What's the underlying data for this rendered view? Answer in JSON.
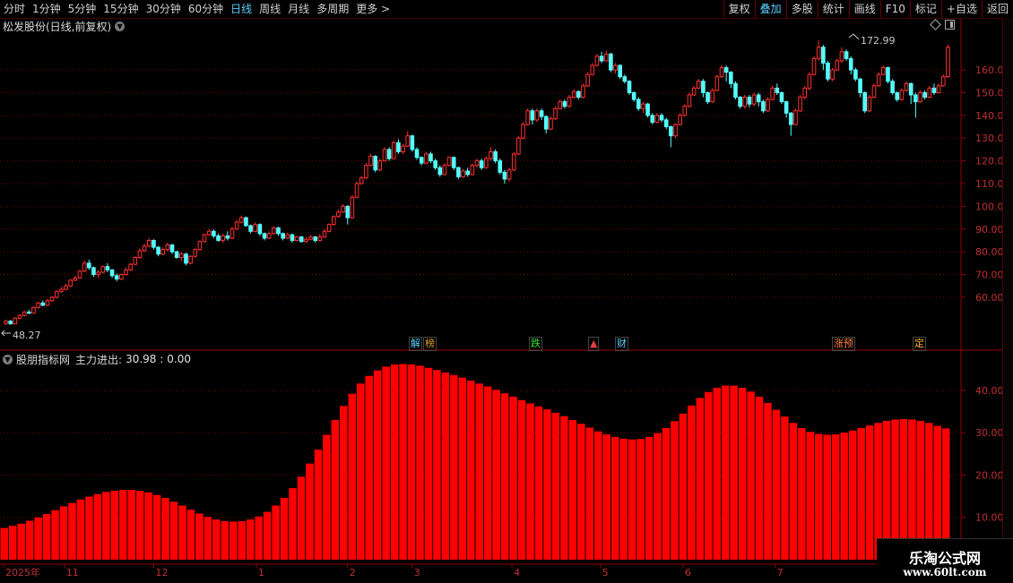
{
  "toolbar": {
    "periods": [
      "分时",
      "1分钟",
      "5分钟",
      "15分钟",
      "30分钟",
      "60分钟",
      "日线",
      "周线",
      "月线",
      "多周期",
      "更多 >"
    ],
    "active_period": "日线",
    "right_buttons": [
      "复权",
      "叠加",
      "多股",
      "统计",
      "画线",
      "F10",
      "标记",
      "+自选",
      "返回"
    ],
    "active_right": "叠加"
  },
  "main": {
    "title": "松发股份(日线,前复权)",
    "high_label": "172.99",
    "low_label": "48.27",
    "price_ticks": [
      "160.0",
      "150.0",
      "140.0",
      "130.0",
      "120.0",
      "110.0",
      "100.0",
      "90.00",
      "80.00",
      "70.00",
      "60.00"
    ]
  },
  "events": [
    {
      "label": "解",
      "color": "#5ad0ff"
    },
    {
      "label": "榜",
      "color": "#e0a020"
    },
    {
      "label": "跌",
      "color": "#30e030"
    },
    {
      "label": "▲",
      "color": "#e04040"
    },
    {
      "label": "财",
      "color": "#5ad0ff"
    },
    {
      "label": "涨预",
      "color": "#ff8040"
    },
    {
      "label": "定",
      "color": "#ffb040"
    }
  ],
  "indicator": {
    "title": "股朋指标网",
    "name": "主力进出:",
    "value": "30.98",
    "value2": ": 0.00",
    "ticks": [
      "40.00",
      "30.00",
      "20.00",
      "10.00"
    ]
  },
  "date_axis": {
    "labels": [
      "2025年",
      "11",
      "12",
      "1",
      "2",
      "3",
      "4",
      "5",
      "6",
      "7"
    ]
  },
  "watermark": {
    "line1": "乐淘公式网",
    "line2": "www.60lt.com"
  },
  "colors": {
    "up": "#ff3030",
    "down": "#54ffff",
    "bar": "#ff0000",
    "grid": "#7a0000",
    "axis_text": "#c03030"
  },
  "chart_data": {
    "type": "candlestick",
    "price_range": [
      45,
      175
    ],
    "indicator_type": "bar",
    "indicator_range": [
      0,
      48
    ],
    "indicator_values": [
      7.5,
      8,
      8.5,
      9.2,
      10,
      10.8,
      11.7,
      12.6,
      13.4,
      14.2,
      14.9,
      15.5,
      16,
      16.3,
      16.5,
      16.5,
      16.3,
      15.9,
      15.3,
      14.6,
      13.7,
      12.8,
      11.8,
      10.9,
      10.1,
      9.5,
      9.1,
      9.0,
      9.1,
      9.5,
      10.2,
      11.3,
      12.8,
      14.6,
      16.9,
      19.6,
      22.7,
      26,
      29.5,
      33,
      36.3,
      39.2,
      41.6,
      43.4,
      44.7,
      45.6,
      46.1,
      46.2,
      46.1,
      45.8,
      45.3,
      44.8,
      44.2,
      43.6,
      43,
      42.3,
      41.6,
      40.9,
      40.1,
      39.3,
      38.5,
      37.7,
      36.9,
      36.2,
      35.5,
      34.7,
      33.9,
      33,
      32.1,
      31.2,
      30.3,
      29.6,
      29,
      28.6,
      28.4,
      28.5,
      29,
      29.9,
      31.1,
      32.7,
      34.5,
      36.4,
      38.2,
      39.6,
      40.6,
      41.1,
      41.1,
      40.6,
      39.7,
      38.5,
      37,
      35.4,
      33.8,
      32.3,
      31.1,
      30.2,
      29.7,
      29.5,
      29.6,
      30,
      30.5,
      31.1,
      31.7,
      32.3,
      32.8,
      33.1,
      33.2,
      33.1,
      32.8,
      32.3,
      31.6,
      31.0
    ],
    "candles": [
      [
        48.5,
        49.5,
        50.2,
        47.8
      ],
      [
        49.5,
        48.3,
        50,
        48
      ],
      [
        48.3,
        50.8,
        51.2,
        48.1
      ],
      [
        50.8,
        52,
        52.5,
        50.2
      ],
      [
        52,
        53.5,
        54,
        51.5
      ],
      [
        53.5,
        53,
        54.5,
        52.5
      ],
      [
        53,
        55.5,
        56,
        52.8
      ],
      [
        55.5,
        57.5,
        58,
        55
      ],
      [
        57.5,
        56.5,
        58.5,
        56
      ],
      [
        56.5,
        58.5,
        59.2,
        56
      ],
      [
        58.5,
        60,
        60.5,
        58
      ],
      [
        60,
        62.5,
        63,
        59.5
      ],
      [
        62.5,
        63.5,
        64.5,
        62
      ],
      [
        63.5,
        65,
        66,
        63
      ],
      [
        65,
        67.5,
        68,
        64.5
      ],
      [
        67.5,
        68.5,
        69.5,
        67
      ],
      [
        68.5,
        71.5,
        72,
        68
      ],
      [
        71.5,
        75,
        76,
        71
      ],
      [
        75,
        73,
        76.5,
        72
      ],
      [
        73,
        70,
        73.5,
        69
      ],
      [
        70,
        71,
        72,
        68.5
      ],
      [
        71,
        73.5,
        74,
        70.5
      ],
      [
        73.5,
        72,
        75,
        71
      ],
      [
        72,
        69.5,
        72.5,
        68.5
      ],
      [
        69.5,
        68,
        70.5,
        67
      ],
      [
        68,
        70,
        70.5,
        67.5
      ],
      [
        70,
        72,
        73,
        69.5
      ],
      [
        72,
        74.5,
        75,
        71.5
      ],
      [
        74.5,
        77.5,
        78,
        74
      ],
      [
        77.5,
        80.5,
        81.5,
        77
      ],
      [
        80.5,
        82.5,
        83.5,
        80
      ],
      [
        82.5,
        85,
        86,
        82
      ],
      [
        85,
        82,
        85.5,
        81
      ],
      [
        82,
        79,
        82.5,
        78
      ],
      [
        79,
        81,
        82,
        78.5
      ],
      [
        81,
        83,
        84,
        80
      ],
      [
        83,
        80,
        83.5,
        79
      ],
      [
        80,
        77.5,
        80.5,
        77
      ],
      [
        77.5,
        79,
        80,
        76
      ],
      [
        79,
        75,
        79.5,
        74
      ],
      [
        75,
        78,
        78.5,
        74.5
      ],
      [
        78,
        81,
        81.5,
        77.5
      ],
      [
        81,
        84.5,
        85,
        80.5
      ],
      [
        84.5,
        87.5,
        88,
        84
      ],
      [
        87.5,
        89,
        90,
        87
      ],
      [
        89,
        87,
        90,
        86
      ],
      [
        87,
        85,
        88,
        84.5
      ],
      [
        85,
        87,
        88,
        84
      ],
      [
        87,
        86,
        89,
        85
      ],
      [
        86,
        90,
        91,
        85.5
      ],
      [
        90,
        93,
        94,
        89.5
      ],
      [
        93,
        95,
        96,
        92.5
      ],
      [
        95,
        91.5,
        95.5,
        91
      ],
      [
        91.5,
        89,
        92,
        88
      ],
      [
        89,
        92,
        93,
        88.5
      ],
      [
        92,
        88,
        92.5,
        87
      ],
      [
        88,
        86,
        88.5,
        85
      ],
      [
        86,
        88,
        89,
        85.5
      ],
      [
        88,
        90.5,
        91,
        87.5
      ],
      [
        90.5,
        88,
        91,
        87
      ],
      [
        88,
        86,
        88.5,
        85
      ],
      [
        86,
        87.5,
        88.5,
        85.5
      ],
      [
        87.5,
        85,
        88,
        84
      ],
      [
        85,
        86.5,
        87,
        84.5
      ],
      [
        86.5,
        84.5,
        87,
        84
      ],
      [
        84.5,
        85.5,
        86.5,
        84
      ],
      [
        85.5,
        86.5,
        87.5,
        85
      ],
      [
        86.5,
        85,
        87,
        84
      ],
      [
        85,
        86.5,
        88,
        84.5
      ],
      [
        86.5,
        89,
        90,
        86
      ],
      [
        89,
        92,
        92.5,
        88.5
      ],
      [
        92,
        95.5,
        96,
        91.5
      ],
      [
        95.5,
        97.5,
        98.5,
        95
      ],
      [
        97.5,
        100,
        101,
        97
      ],
      [
        100,
        95,
        100.5,
        92
      ],
      [
        95,
        104,
        105,
        94.5
      ],
      [
        104,
        110,
        111,
        103.5
      ],
      [
        110,
        112.5,
        113.5,
        109.5
      ],
      [
        112.5,
        118,
        119,
        112
      ],
      [
        118,
        122,
        123,
        117.5
      ],
      [
        122,
        116,
        122.5,
        115
      ],
      [
        116,
        120,
        121,
        115.5
      ],
      [
        120,
        125,
        126,
        119.5
      ],
      [
        125,
        121,
        126,
        120
      ],
      [
        121,
        128,
        129,
        120.5
      ],
      [
        128,
        124,
        129.5,
        123
      ],
      [
        124,
        126.5,
        127.5,
        123
      ],
      [
        126.5,
        131,
        133,
        126
      ],
      [
        131,
        125,
        131.5,
        124
      ],
      [
        125,
        121.5,
        126,
        120.5
      ],
      [
        121.5,
        119,
        122,
        118
      ],
      [
        119,
        123,
        124,
        118.5
      ],
      [
        123,
        120,
        124,
        119
      ],
      [
        120,
        117,
        121,
        116
      ],
      [
        117,
        114,
        118,
        113
      ],
      [
        114,
        118,
        119,
        113.5
      ],
      [
        118,
        121.5,
        122,
        117.5
      ],
      [
        121.5,
        117,
        122,
        116
      ],
      [
        117,
        113,
        117.5,
        112
      ],
      [
        113,
        115.5,
        116.5,
        112.5
      ],
      [
        115.5,
        114,
        117,
        113
      ],
      [
        114,
        118,
        119,
        113.5
      ],
      [
        118,
        120,
        121,
        117
      ],
      [
        120,
        117,
        121,
        116
      ],
      [
        117,
        121,
        122,
        116.5
      ],
      [
        121,
        124,
        126,
        120
      ],
      [
        124,
        120,
        125,
        119
      ],
      [
        120,
        115,
        121,
        114
      ],
      [
        115,
        112,
        116,
        110
      ],
      [
        112,
        116,
        117,
        111
      ],
      [
        116,
        123,
        124,
        115.5
      ],
      [
        123,
        130,
        131,
        122.5
      ],
      [
        130,
        136,
        137,
        129.5
      ],
      [
        136,
        142,
        143,
        135.5
      ],
      [
        142,
        138,
        143,
        136
      ],
      [
        138,
        142,
        143,
        137
      ],
      [
        142,
        139.5,
        143,
        138
      ],
      [
        139.5,
        134,
        140,
        132
      ],
      [
        134,
        138.5,
        139.5,
        133.5
      ],
      [
        138.5,
        143,
        144,
        138
      ],
      [
        143,
        146,
        147,
        142.5
      ],
      [
        146,
        144,
        147,
        143
      ],
      [
        144,
        148,
        149,
        143.5
      ],
      [
        148,
        150.5,
        151.5,
        147.5
      ],
      [
        150.5,
        148,
        151,
        147
      ],
      [
        148,
        153,
        154,
        147.5
      ],
      [
        153,
        158,
        159,
        152.5
      ],
      [
        158,
        162,
        163,
        157.5
      ],
      [
        162,
        166,
        167,
        161.5
      ],
      [
        166,
        164,
        168,
        163
      ],
      [
        164,
        167,
        168.5,
        163.5
      ],
      [
        167,
        160,
        167.5,
        159
      ],
      [
        160,
        162,
        163,
        158.5
      ],
      [
        162,
        157,
        162.5,
        156
      ],
      [
        157,
        155,
        158,
        154
      ],
      [
        155,
        150,
        155.5,
        149
      ],
      [
        150,
        147,
        150.5,
        146
      ],
      [
        147,
        143,
        148,
        142
      ],
      [
        143,
        145,
        146,
        141
      ],
      [
        145,
        140,
        145.5,
        139
      ],
      [
        140,
        137,
        141,
        136
      ],
      [
        137,
        140,
        141,
        136.5
      ],
      [
        140,
        138,
        141,
        137
      ],
      [
        138,
        135,
        139,
        134
      ],
      [
        135,
        131,
        135.5,
        126
      ],
      [
        131,
        136,
        136.5,
        130
      ],
      [
        136,
        140,
        141,
        135.5
      ],
      [
        140,
        144,
        145,
        139.5
      ],
      [
        144,
        149,
        150,
        143.5
      ],
      [
        149,
        152,
        153,
        148.5
      ],
      [
        152,
        155,
        156,
        151.5
      ],
      [
        155,
        150,
        156,
        148
      ],
      [
        150,
        146,
        150.5,
        145
      ],
      [
        146,
        151,
        152,
        145.5
      ],
      [
        151,
        157,
        158,
        150.5
      ],
      [
        157,
        161,
        162,
        156.5
      ],
      [
        161,
        159,
        162,
        155
      ],
      [
        159,
        154,
        159.5,
        152
      ],
      [
        154,
        148,
        155,
        147
      ],
      [
        148,
        144,
        148.5,
        143
      ],
      [
        144,
        148,
        149,
        143
      ],
      [
        148,
        145,
        149,
        143.5
      ],
      [
        145,
        149,
        150,
        144
      ],
      [
        149,
        146,
        150,
        144
      ],
      [
        146,
        142,
        147,
        141
      ],
      [
        142,
        147,
        148,
        141.5
      ],
      [
        147,
        152,
        153,
        146.5
      ],
      [
        152,
        150,
        154,
        149
      ],
      [
        150,
        146,
        150.5,
        145
      ],
      [
        146,
        141,
        146.5,
        139
      ],
      [
        141,
        136,
        141.5,
        131
      ],
      [
        136,
        142,
        143,
        135.5
      ],
      [
        142,
        148,
        149,
        141.5
      ],
      [
        148,
        152,
        153,
        147
      ],
      [
        152,
        158,
        159,
        151
      ],
      [
        158,
        165,
        166,
        157.5
      ],
      [
        165,
        170,
        173,
        164
      ],
      [
        170,
        163,
        171,
        160
      ],
      [
        163,
        156,
        164,
        155
      ],
      [
        156,
        160,
        161,
        155
      ],
      [
        160,
        164,
        165,
        159.5
      ],
      [
        164,
        168,
        170,
        163
      ],
      [
        168,
        165,
        169,
        164
      ],
      [
        165,
        160,
        166,
        158
      ],
      [
        160,
        156,
        161,
        155
      ],
      [
        156,
        150,
        156.5,
        148
      ],
      [
        150,
        142,
        150.5,
        141
      ],
      [
        142,
        148,
        149,
        141.5
      ],
      [
        148,
        153,
        154,
        147.5
      ],
      [
        153,
        158,
        159,
        152.5
      ],
      [
        158,
        161,
        162,
        157.5
      ],
      [
        161,
        155,
        161.5,
        154
      ],
      [
        155,
        150,
        156,
        149
      ],
      [
        150,
        147,
        150.5,
        146
      ],
      [
        147,
        151,
        152,
        146.5
      ],
      [
        151,
        154,
        155,
        150.5
      ],
      [
        154,
        149,
        154.5,
        145
      ],
      [
        149,
        146,
        150,
        139
      ],
      [
        146,
        150,
        151,
        145.5
      ],
      [
        150,
        148,
        151,
        147
      ],
      [
        148,
        152,
        153,
        147.5
      ],
      [
        152,
        150,
        154,
        149
      ],
      [
        150,
        153,
        154,
        149.5
      ],
      [
        153,
        157,
        158,
        152.5
      ],
      [
        157,
        170,
        171,
        156.5
      ]
    ]
  }
}
